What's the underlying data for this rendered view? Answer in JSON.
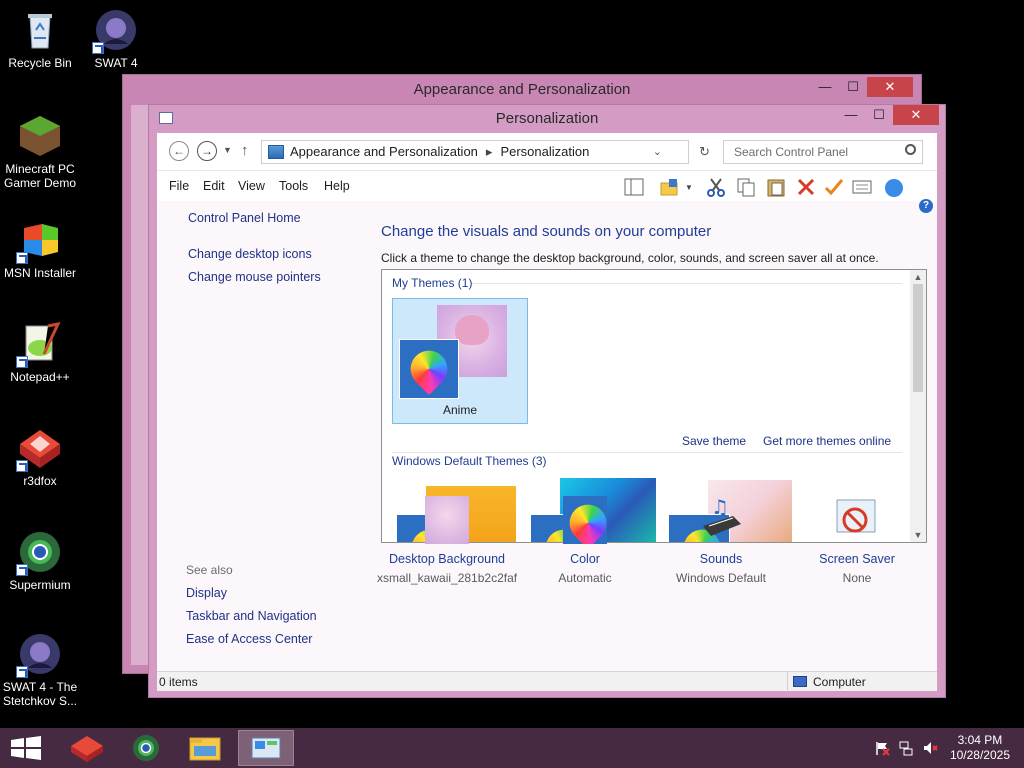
{
  "desktop": {
    "icons": [
      {
        "label": "Recycle Bin"
      },
      {
        "label": "SWAT 4"
      },
      {
        "label": "Minecraft PC Gamer Demo"
      },
      {
        "label": "MSN Installer"
      },
      {
        "label": "Notepad++"
      },
      {
        "label": "r3dfox"
      },
      {
        "label": "Supermium"
      },
      {
        "label": "SWAT 4 - The Stetchkov S..."
      }
    ]
  },
  "back_window": {
    "title": "Appearance and Personalization"
  },
  "window": {
    "title": "Personalization",
    "controls": {
      "minimize": "—",
      "maximize": "☐",
      "close": "✕"
    },
    "address": {
      "crumb1": "Appearance and Personalization",
      "crumb2": "Personalization"
    },
    "search": {
      "placeholder": "Search Control Panel"
    },
    "menu": {
      "file": "File",
      "edit": "Edit",
      "view": "View",
      "tools": "Tools",
      "help": "Help"
    },
    "left": {
      "home": "Control Panel Home",
      "desktop_icons": "Change desktop icons",
      "mouse_pointers": "Change mouse pointers",
      "see_also": "See also",
      "display": "Display",
      "taskbar": "Taskbar and Navigation",
      "ease": "Ease of Access Center"
    },
    "main": {
      "heading": "Change the visuals and sounds on your computer",
      "subheading": "Click a theme to change the desktop background, color, sounds, and screen saver all at once.",
      "my_themes": "My Themes (1)",
      "selected_theme": "Anime",
      "save_theme": "Save theme",
      "more_themes": "Get more themes online",
      "default_themes": "Windows Default Themes (3)"
    },
    "bottom": {
      "background_label": "Desktop Background",
      "background_value": "xsmall_kawaii_281b2c2faf",
      "color_label": "Color",
      "color_value": "Automatic",
      "sounds_label": "Sounds",
      "sounds_value": "Windows Default",
      "saver_label": "Screen Saver",
      "saver_value": "None"
    },
    "status": {
      "items": "0 items",
      "location": "Computer"
    }
  },
  "taskbar": {
    "time": "3:04 PM",
    "date": "10/28/2025"
  },
  "colors": {
    "accent": "#d49cc5",
    "taskbar": "#462a42",
    "link": "#1e3287"
  }
}
